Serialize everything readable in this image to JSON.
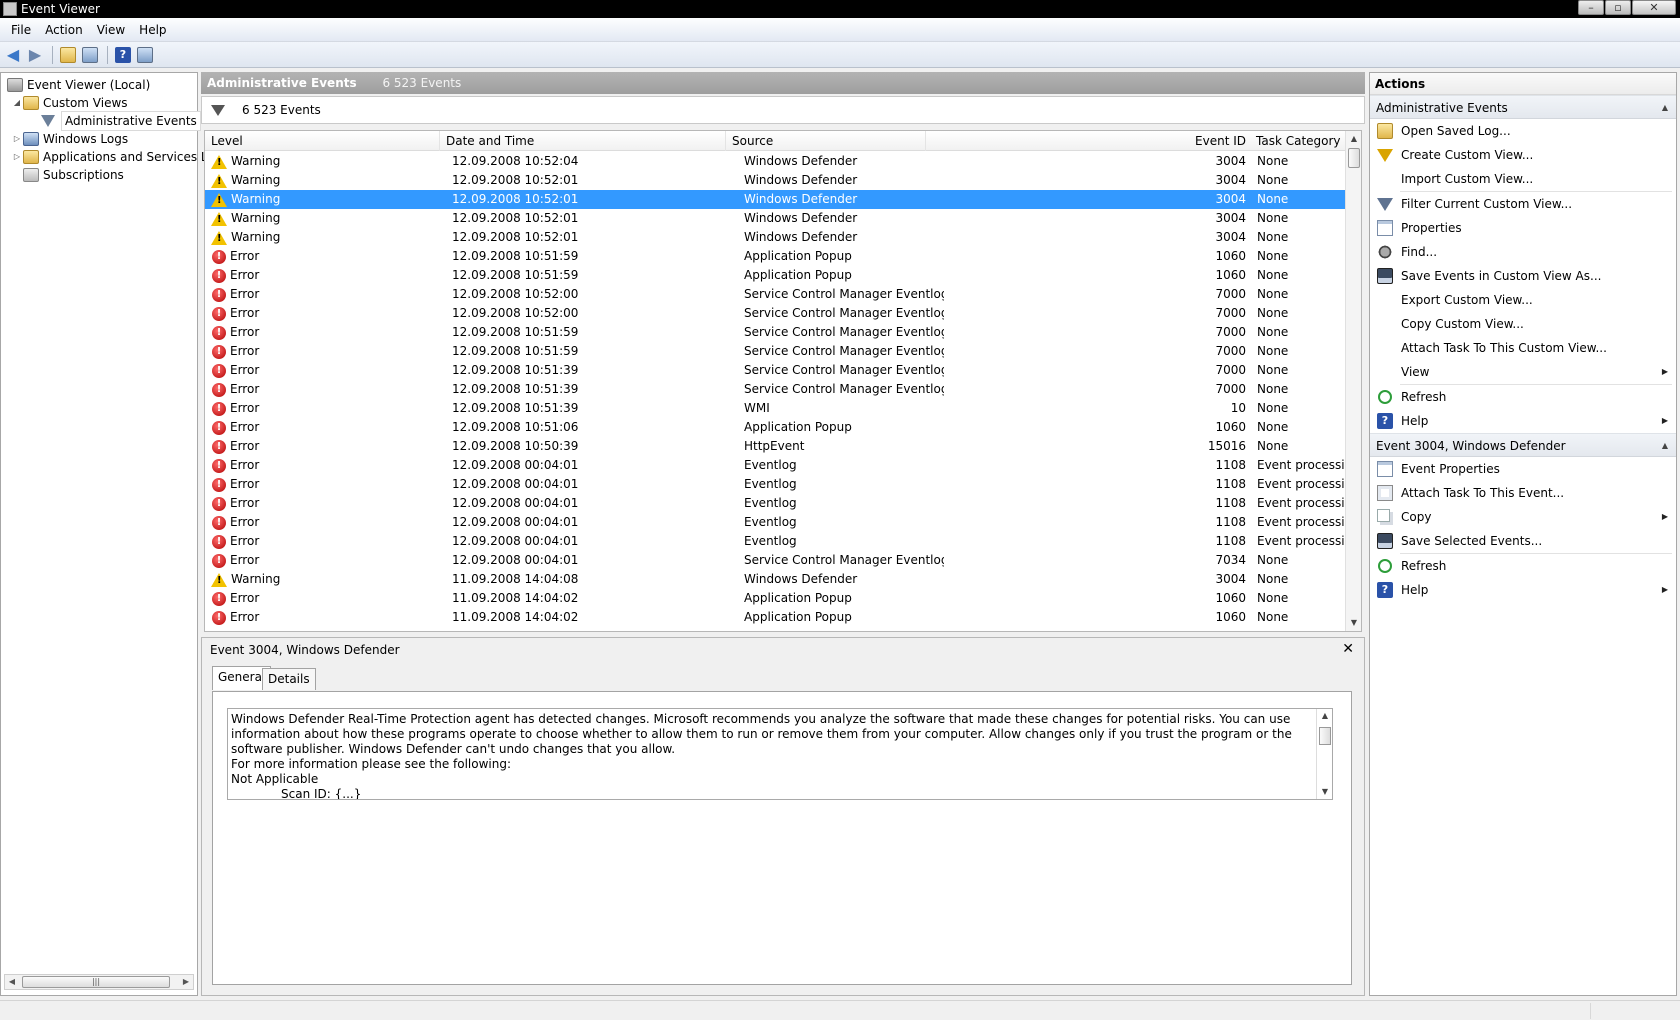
{
  "window": {
    "title": "Event Viewer"
  },
  "menu": [
    "File",
    "Action",
    "View",
    "Help"
  ],
  "tree": {
    "root": "Event Viewer (Local)",
    "custom_views": "Custom Views",
    "admin_events": "Administrative Events",
    "windows_logs": "Windows Logs",
    "apps_services": "Applications and Services Lo",
    "subscriptions": "Subscriptions"
  },
  "center": {
    "title": "Administrative Events",
    "count": "6 523 Events",
    "filter_text": "6 523 Events",
    "columns": {
      "level": "Level",
      "date": "Date and Time",
      "source": "Source",
      "event_id": "Event ID",
      "category": "Task Category"
    },
    "rows": [
      {
        "level": "Warning",
        "date": "12.09.2008 10:52:04",
        "source": "Windows Defender",
        "id": "3004",
        "category": "None"
      },
      {
        "level": "Warning",
        "date": "12.09.2008 10:52:01",
        "source": "Windows Defender",
        "id": "3004",
        "category": "None"
      },
      {
        "level": "Warning",
        "date": "12.09.2008 10:52:01",
        "source": "Windows Defender",
        "id": "3004",
        "category": "None",
        "selected": true
      },
      {
        "level": "Warning",
        "date": "12.09.2008 10:52:01",
        "source": "Windows Defender",
        "id": "3004",
        "category": "None"
      },
      {
        "level": "Warning",
        "date": "12.09.2008 10:52:01",
        "source": "Windows Defender",
        "id": "3004",
        "category": "None"
      },
      {
        "level": "Error",
        "date": "12.09.2008 10:51:59",
        "source": "Application Popup",
        "id": "1060",
        "category": "None"
      },
      {
        "level": "Error",
        "date": "12.09.2008 10:51:59",
        "source": "Application Popup",
        "id": "1060",
        "category": "None"
      },
      {
        "level": "Error",
        "date": "12.09.2008 10:52:00",
        "source": "Service Control Manager Eventlog...",
        "id": "7000",
        "category": "None"
      },
      {
        "level": "Error",
        "date": "12.09.2008 10:52:00",
        "source": "Service Control Manager Eventlog...",
        "id": "7000",
        "category": "None"
      },
      {
        "level": "Error",
        "date": "12.09.2008 10:51:59",
        "source": "Service Control Manager Eventlog...",
        "id": "7000",
        "category": "None"
      },
      {
        "level": "Error",
        "date": "12.09.2008 10:51:59",
        "source": "Service Control Manager Eventlog...",
        "id": "7000",
        "category": "None"
      },
      {
        "level": "Error",
        "date": "12.09.2008 10:51:39",
        "source": "Service Control Manager Eventlog...",
        "id": "7000",
        "category": "None"
      },
      {
        "level": "Error",
        "date": "12.09.2008 10:51:39",
        "source": "Service Control Manager Eventlog...",
        "id": "7000",
        "category": "None"
      },
      {
        "level": "Error",
        "date": "12.09.2008 10:51:39",
        "source": "WMI",
        "id": "10",
        "category": "None"
      },
      {
        "level": "Error",
        "date": "12.09.2008 10:51:06",
        "source": "Application Popup",
        "id": "1060",
        "category": "None"
      },
      {
        "level": "Error",
        "date": "12.09.2008 10:50:39",
        "source": "HttpEvent",
        "id": "15016",
        "category": "None"
      },
      {
        "level": "Error",
        "date": "12.09.2008 00:04:01",
        "source": "Eventlog",
        "id": "1108",
        "category": "Event processing"
      },
      {
        "level": "Error",
        "date": "12.09.2008 00:04:01",
        "source": "Eventlog",
        "id": "1108",
        "category": "Event processing"
      },
      {
        "level": "Error",
        "date": "12.09.2008 00:04:01",
        "source": "Eventlog",
        "id": "1108",
        "category": "Event processing"
      },
      {
        "level": "Error",
        "date": "12.09.2008 00:04:01",
        "source": "Eventlog",
        "id": "1108",
        "category": "Event processing"
      },
      {
        "level": "Error",
        "date": "12.09.2008 00:04:01",
        "source": "Eventlog",
        "id": "1108",
        "category": "Event processing"
      },
      {
        "level": "Error",
        "date": "12.09.2008 00:04:01",
        "source": "Service Control Manager Eventlog...",
        "id": "7034",
        "category": "None"
      },
      {
        "level": "Warning",
        "date": "11.09.2008 14:04:08",
        "source": "Windows Defender",
        "id": "3004",
        "category": "None"
      },
      {
        "level": "Error",
        "date": "11.09.2008 14:04:02",
        "source": "Application Popup",
        "id": "1060",
        "category": "None"
      },
      {
        "level": "Error",
        "date": "11.09.2008 14:04:02",
        "source": "Application Popup",
        "id": "1060",
        "category": "None"
      }
    ]
  },
  "detail": {
    "title": "Event 3004, Windows Defender",
    "close_glyph": "✕",
    "tabs": [
      "General",
      "Details"
    ],
    "description": "Windows Defender Real-Time Protection agent has detected changes. Microsoft recommends you analyze the software that made these changes for potential risks. You can use information about how these programs operate to choose whether to allow them to run or remove them from your computer.  Allow changes only if you trust the program or the software publisher. Windows Defender can't undo changes that you allow.",
    "more_info": " For more information please see the following:",
    "not_applicable": "Not Applicable",
    "scan_id": "Scan ID: {...}"
  },
  "actions": {
    "title": "Actions",
    "section1": "Administrative Events",
    "section1_items": [
      {
        "label": "Open Saved Log...",
        "icon": "open-log-icon"
      },
      {
        "label": "Create Custom View...",
        "icon": "create-view-icon"
      },
      {
        "label": "Import Custom View...",
        "icon": "none"
      },
      {
        "label": "Filter Current Custom View...",
        "icon": "filter-icon"
      },
      {
        "label": "Properties",
        "icon": "properties-icon"
      },
      {
        "label": "Find...",
        "icon": "find-icon"
      },
      {
        "label": "Save Events in Custom View As...",
        "icon": "save-icon"
      },
      {
        "label": "Export Custom View...",
        "icon": "none"
      },
      {
        "label": "Copy Custom View...",
        "icon": "none"
      },
      {
        "label": "Attach Task To This Custom View...",
        "icon": "none"
      },
      {
        "label": "View",
        "icon": "none",
        "submenu": true
      },
      {
        "label": "Refresh",
        "icon": "refresh-icon"
      },
      {
        "label": "Help",
        "icon": "help-icon",
        "submenu": true
      }
    ],
    "section2": "Event 3004, Windows Defender",
    "section2_items": [
      {
        "label": "Event Properties",
        "icon": "event-properties-icon"
      },
      {
        "label": "Attach Task To This Event...",
        "icon": "attach-task-icon"
      },
      {
        "label": "Copy",
        "icon": "copy-icon",
        "submenu": true
      },
      {
        "label": "Save Selected Events...",
        "icon": "save-icon"
      },
      {
        "label": "Refresh",
        "icon": "refresh-icon"
      },
      {
        "label": "Help",
        "icon": "help-icon",
        "submenu": true
      }
    ]
  }
}
